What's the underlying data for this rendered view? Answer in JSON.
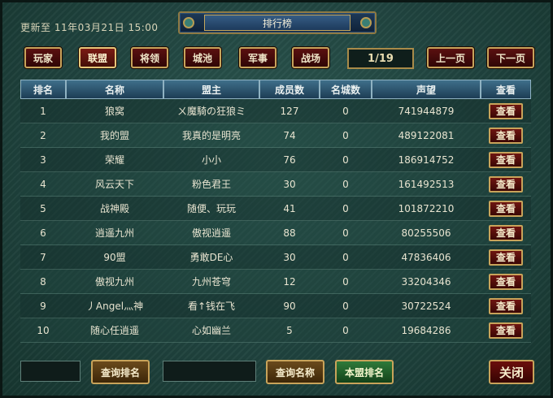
{
  "header": {
    "updated_text": "更新至 11年03月21日 15:00",
    "title": "排行榜"
  },
  "tabs": [
    {
      "label": "玩家",
      "active": false
    },
    {
      "label": "联盟",
      "active": true
    },
    {
      "label": "将领",
      "active": false
    },
    {
      "label": "城池",
      "active": false
    },
    {
      "label": "军事",
      "active": false
    },
    {
      "label": "战场",
      "active": false
    }
  ],
  "pager": {
    "page_indicator": "1/19",
    "prev_label": "上一页",
    "next_label": "下一页"
  },
  "table": {
    "columns": [
      "排名",
      "名称",
      "盟主",
      "成员数",
      "名城数",
      "声望",
      "查看"
    ],
    "view_label": "查看",
    "rows": [
      {
        "rank": "1",
        "name": "狼窝",
        "leader": "ㄨ魔騎の狂狼ミ",
        "members": "127",
        "cities": "0",
        "prestige": "741944879"
      },
      {
        "rank": "2",
        "name": "我的盟",
        "leader": "我真的是明亮",
        "members": "74",
        "cities": "0",
        "prestige": "489122081"
      },
      {
        "rank": "3",
        "name": "荣耀",
        "leader": "小小",
        "members": "76",
        "cities": "0",
        "prestige": "186914752"
      },
      {
        "rank": "4",
        "name": "风云天下",
        "leader": "粉色君王",
        "members": "30",
        "cities": "0",
        "prestige": "161492513"
      },
      {
        "rank": "5",
        "name": "战神殿",
        "leader": "随便、玩玩",
        "members": "41",
        "cities": "0",
        "prestige": "101872210"
      },
      {
        "rank": "6",
        "name": "逍遥九州",
        "leader": "傲视逍遥",
        "members": "88",
        "cities": "0",
        "prestige": "80255506"
      },
      {
        "rank": "7",
        "name": "90盟",
        "leader": "勇敢DE心",
        "members": "30",
        "cities": "0",
        "prestige": "47836406"
      },
      {
        "rank": "8",
        "name": "傲视九州",
        "leader": "九州苍穹",
        "members": "12",
        "cities": "0",
        "prestige": "33204346"
      },
      {
        "rank": "9",
        "name": "丿Angel灬神",
        "leader": "看↑钱在飞",
        "members": "90",
        "cities": "0",
        "prestige": "30722524"
      },
      {
        "rank": "10",
        "name": "随心任逍遥",
        "leader": "心如幽兰",
        "members": "5",
        "cities": "0",
        "prestige": "19684286"
      }
    ]
  },
  "footer": {
    "rank_input_value": "",
    "query_rank_label": "查询排名",
    "name_input_value": "",
    "query_name_label": "查询名称",
    "my_alliance_rank_label": "本盟排名",
    "close_label": "关闭"
  }
}
